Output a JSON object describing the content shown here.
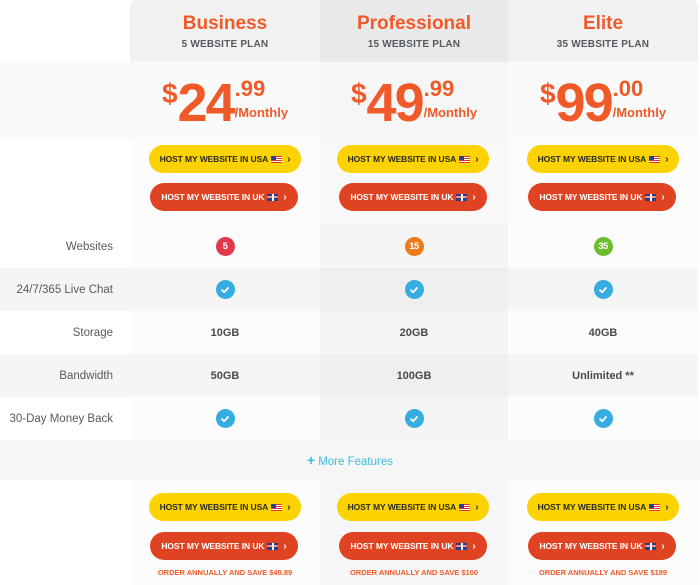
{
  "colors": {
    "accent_orange": "#f05a28",
    "usa_button": "#fcd200",
    "uk_button": "#e04321",
    "check": "#36ace2",
    "link": "#3dbbe3"
  },
  "plans": [
    {
      "name": "Business",
      "subtitle": "5 WEBSITE PLAN",
      "price": {
        "currency": "$",
        "integer": "24",
        "decimal": ".99",
        "period": "/Monthly"
      },
      "buttons": {
        "usa": "HOST MY WEBSITE IN USA",
        "uk": "HOST MY WEBSITE IN UK"
      },
      "save_note": "ORDER ANNUALLY AND SAVE $49.89",
      "websites_badge": {
        "value": "5",
        "color": "#e03a4a"
      },
      "live_chat": true,
      "storage": "10GB",
      "bandwidth": "50GB",
      "money_back": true
    },
    {
      "name": "Professional",
      "subtitle": "15 WEBSITE PLAN",
      "price": {
        "currency": "$",
        "integer": "49",
        "decimal": ".99",
        "period": "/Monthly"
      },
      "buttons": {
        "usa": "HOST MY WEBSITE IN USA",
        "uk": "HOST MY WEBSITE IN UK"
      },
      "save_note": "ORDER ANNUALLY AND SAVE $100",
      "websites_badge": {
        "value": "15",
        "color": "#f07a1a"
      },
      "live_chat": true,
      "storage": "20GB",
      "bandwidth": "100GB",
      "money_back": true
    },
    {
      "name": "Elite",
      "subtitle": "35 WEBSITE PLAN",
      "price": {
        "currency": "$",
        "integer": "99",
        "decimal": ".00",
        "period": "/Monthly"
      },
      "buttons": {
        "usa": "HOST MY WEBSITE IN USA",
        "uk": "HOST MY WEBSITE IN UK"
      },
      "save_note": "ORDER ANNUALLY AND SAVE $189",
      "websites_badge": {
        "value": "35",
        "color": "#6cbd2c"
      },
      "live_chat": true,
      "storage": "40GB",
      "bandwidth": "Unlimited **",
      "money_back": true
    }
  ],
  "feature_labels": [
    "Websites",
    "24/7/365 Live Chat",
    "Storage",
    "Bandwidth",
    "30-Day Money Back"
  ],
  "more_features": {
    "icon": "plus-icon",
    "label": "More Features"
  },
  "icons": {
    "usa_flag": "us-flag-icon",
    "uk_flag": "uk-flag-icon",
    "chevron": "chevron-right-icon",
    "check": "check-circle-icon"
  },
  "glyphs": {
    "chevron": "›",
    "plus": "+"
  }
}
